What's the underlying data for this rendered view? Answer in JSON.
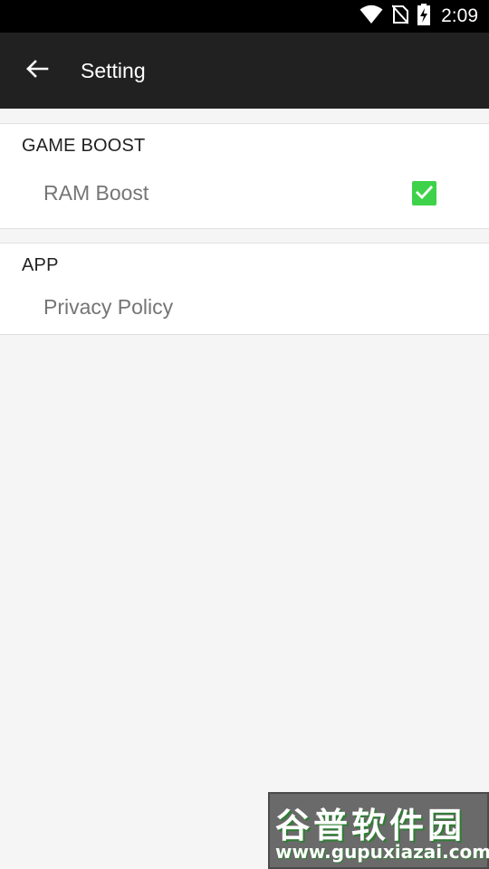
{
  "status_bar": {
    "time": "2:09",
    "icons": [
      "wifi-icon",
      "no-sim-icon",
      "battery-charging-icon"
    ]
  },
  "toolbar": {
    "back_icon": "arrow-left-icon",
    "title": "Setting"
  },
  "sections": [
    {
      "header": "GAME BOOST",
      "items": [
        {
          "label": "RAM Boost",
          "checked": true
        }
      ]
    },
    {
      "header": "APP",
      "items": [
        {
          "label": "Privacy Policy"
        }
      ]
    }
  ],
  "colors": {
    "status_bar_bg": "#000000",
    "toolbar_bg": "#212121",
    "page_bg": "#f5f5f5",
    "checkbox_checked": "#3ed24a",
    "label_text": "#757575"
  },
  "watermark": {
    "logo_text": "谷普软件园",
    "url": "www.gupuxiazai.com"
  }
}
